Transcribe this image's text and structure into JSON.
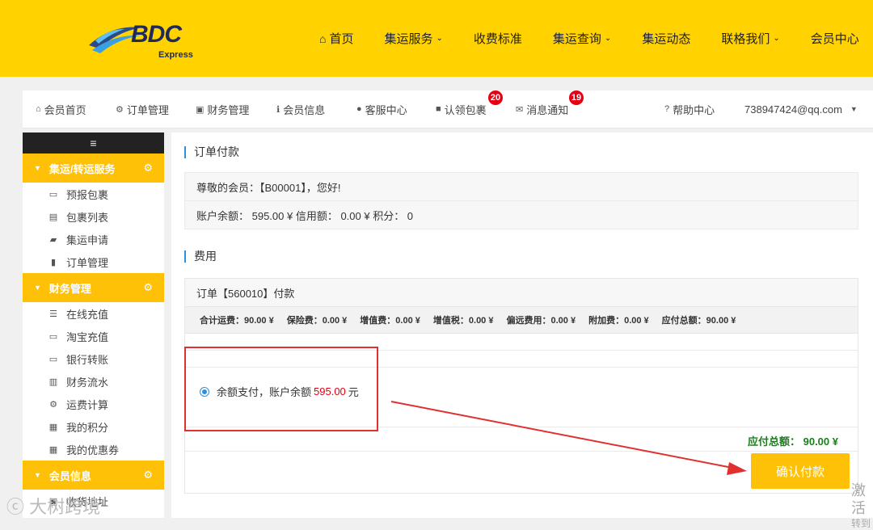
{
  "header": {
    "logo": {
      "text": "BDC",
      "sub": "Express"
    },
    "nav": [
      {
        "label": "首页",
        "icon": "home-icon",
        "dropdown": false
      },
      {
        "label": "集运服务",
        "dropdown": true
      },
      {
        "label": "收费标准",
        "dropdown": false
      },
      {
        "label": "集运查询",
        "dropdown": true
      },
      {
        "label": "集运动态",
        "dropdown": false
      },
      {
        "label": "联格我们",
        "dropdown": true
      },
      {
        "label": "会员中心",
        "dropdown": false
      }
    ]
  },
  "member_bar": {
    "items": [
      {
        "label": "会员首页",
        "icon": "home-icon"
      },
      {
        "label": "订单管理",
        "icon": "gear-icon"
      },
      {
        "label": "财务管理",
        "icon": "money-icon"
      },
      {
        "label": "会员信息",
        "icon": "info-icon"
      },
      {
        "label": "客服中心",
        "icon": "user-icon"
      },
      {
        "label": "认领包裹",
        "icon": "package-icon",
        "badge": "20"
      },
      {
        "label": "消息通知",
        "icon": "envelope-icon",
        "badge": "19"
      },
      {
        "label": "帮助中心",
        "icon": "help-icon"
      }
    ],
    "account": "738947424@qq.com"
  },
  "sidebar": {
    "groups": [
      {
        "label": "集运/转运服务",
        "items": [
          {
            "label": "预报包裹",
            "icon": "print-icon"
          },
          {
            "label": "包裹列表",
            "icon": "list-icon"
          },
          {
            "label": "集运申请",
            "icon": "truck-icon"
          },
          {
            "label": "订单管理",
            "icon": "book-icon"
          }
        ]
      },
      {
        "label": "财务管理",
        "items": [
          {
            "label": "在线充值",
            "icon": "server-icon"
          },
          {
            "label": "淘宝充值",
            "icon": "card-icon"
          },
          {
            "label": "银行转账",
            "icon": "card-icon"
          },
          {
            "label": "财务流水",
            "icon": "chart-icon"
          },
          {
            "label": "运费计算",
            "icon": "gears-icon"
          },
          {
            "label": "我的积分",
            "icon": "gift-icon"
          },
          {
            "label": "我的优惠券",
            "icon": "gift-icon"
          }
        ]
      },
      {
        "label": "会员信息",
        "items": [
          {
            "label": "收货地址",
            "icon": "address-icon"
          }
        ]
      }
    ]
  },
  "content": {
    "section1_title": "订单付款",
    "greeting": "尊敬的会员：【B00001】，您好!",
    "balance_line": "账户余额：  595.00 ¥    信用额：  0.00 ¥    积分：  0",
    "section2_title": "费用",
    "order_title": "订单【560010】付款",
    "fees": [
      "合计运费：90.00 ¥",
      "保险费：0.00 ¥",
      "增值费：0.00 ¥",
      "增值税：0.00 ¥",
      "偏远费用：0.00 ¥",
      "附加费：0.00 ¥",
      "应付总额：90.00 ¥"
    ],
    "payment_option": {
      "prefix": "余额支付，账户余额",
      "amount": "595.00",
      "suffix": "元"
    },
    "total_line": "应付总额：  90.00 ¥",
    "confirm_label": "确认付款"
  },
  "watermark": "大树跨境",
  "activate_windows": {
    "line1": "激活",
    "line2": "转到"
  }
}
